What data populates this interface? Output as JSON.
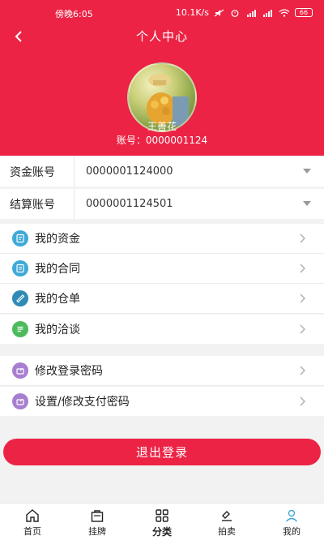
{
  "status_bar": {
    "time": "傍晚6:05",
    "network_speed": "10.1K/s",
    "battery": "66"
  },
  "header": {
    "title": "个人中心",
    "user_name": "王善花",
    "account_label": "账号：0000001124"
  },
  "accounts": [
    {
      "label": "资金账号",
      "value": "0000001124000"
    },
    {
      "label": "结算账号",
      "value": "0000001124501"
    }
  ],
  "menu_group_1": [
    {
      "label": "我的资金",
      "icon": "wallet-icon",
      "color": "#3fa9d8"
    },
    {
      "label": "我的合同",
      "icon": "contract-icon",
      "color": "#3fa9d8"
    },
    {
      "label": "我的仓单",
      "icon": "warehouse-receipt-icon",
      "color": "#2f8bb5"
    },
    {
      "label": "我的洽谈",
      "icon": "chat-icon",
      "color": "#4cbb5c"
    }
  ],
  "menu_group_2": [
    {
      "label": "修改登录密码",
      "icon": "lock-edit-icon",
      "color": "#a87fd0"
    },
    {
      "label": "设置/修改支付密码",
      "icon": "pay-edit-icon",
      "color": "#a87fd0"
    }
  ],
  "logout_label": "退出登录",
  "tabs": [
    {
      "label": "首页",
      "icon": "home-icon"
    },
    {
      "label": "挂牌",
      "icon": "bag-icon"
    },
    {
      "label": "分类",
      "icon": "grid-icon"
    },
    {
      "label": "拍卖",
      "icon": "gavel-icon"
    },
    {
      "label": "我的",
      "icon": "user-icon",
      "active": true
    }
  ],
  "colors": {
    "brand": "#ec2345",
    "active_tab": "#3fa9d8"
  }
}
